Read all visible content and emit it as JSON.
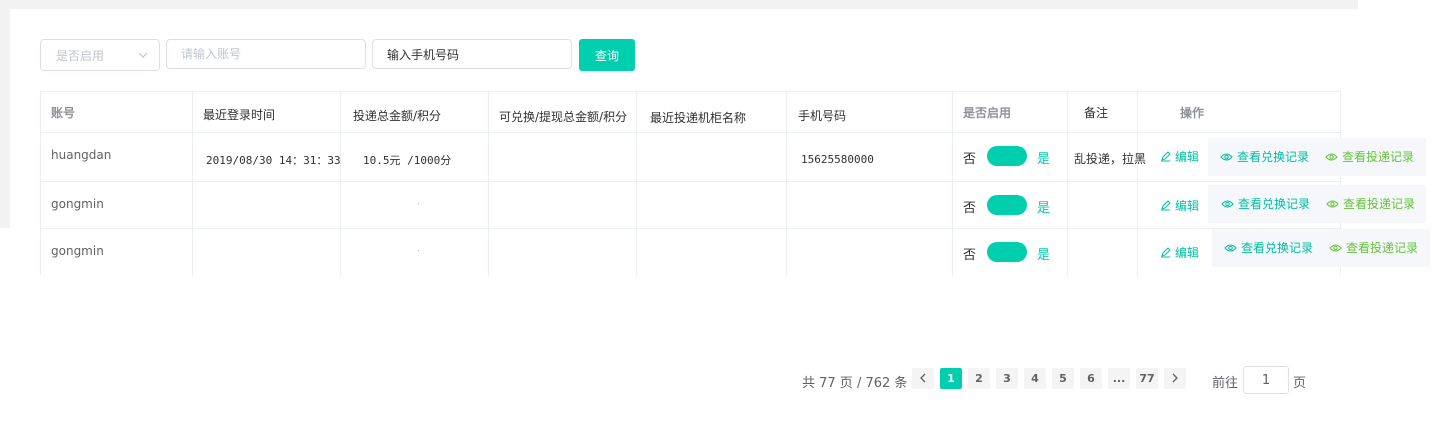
{
  "filters": {
    "enabled_select": {
      "value": "是否启用"
    },
    "account_input": {
      "placeholder": "请输入账号"
    },
    "phone_input": {
      "value": "输入手机号码"
    },
    "query_button": "查询"
  },
  "table": {
    "headers": [
      "账号",
      "最近登录时间",
      "投递总金额/积分",
      "可兑换/提现总金额/积分",
      "最近投递机柜名称",
      "手机号码",
      "是否启用",
      "备注",
      "操作"
    ],
    "rows": [
      {
        "account": "huangdan",
        "last_login": "2019/08/30 14：31：33",
        "total": "10.5元 /1000分",
        "exchangeable": "",
        "cabinet": "",
        "phone": "15625580000",
        "toggle_off": "否",
        "toggle_on": "是",
        "enabled": true,
        "remark": "乱投递，拉黑"
      },
      {
        "account": "gongmin",
        "last_login": "",
        "total": "",
        "exchangeable": "",
        "cabinet": "",
        "phone": "",
        "toggle_off": "否",
        "toggle_on": "是",
        "enabled": true,
        "remark": ""
      },
      {
        "account": "gongmin",
        "last_login": "",
        "total": "",
        "exchangeable": "",
        "cabinet": "",
        "phone": "",
        "toggle_off": "否",
        "toggle_on": "是",
        "enabled": true,
        "remark": ""
      }
    ],
    "actions": {
      "edit": "编辑",
      "view_exchange": "查看兑换记录",
      "view_delivery": "查看投递记录"
    }
  },
  "pagination": {
    "summary": "共 77 页 / 762 条",
    "pages": [
      "1",
      "2",
      "3",
      "4",
      "5",
      "6",
      "...",
      "77"
    ],
    "current_page": 1,
    "goto_prefix": "前往",
    "goto_value": "1",
    "goto_suffix": "页"
  },
  "colors": {
    "accent": "#00cfaf",
    "link_teal": "#00bfa0",
    "link_green": "#67c23a"
  },
  "icons": [
    "chevron-down-icon",
    "edit-icon",
    "eye-icon",
    "chevron-left-icon",
    "chevron-right-icon"
  ]
}
